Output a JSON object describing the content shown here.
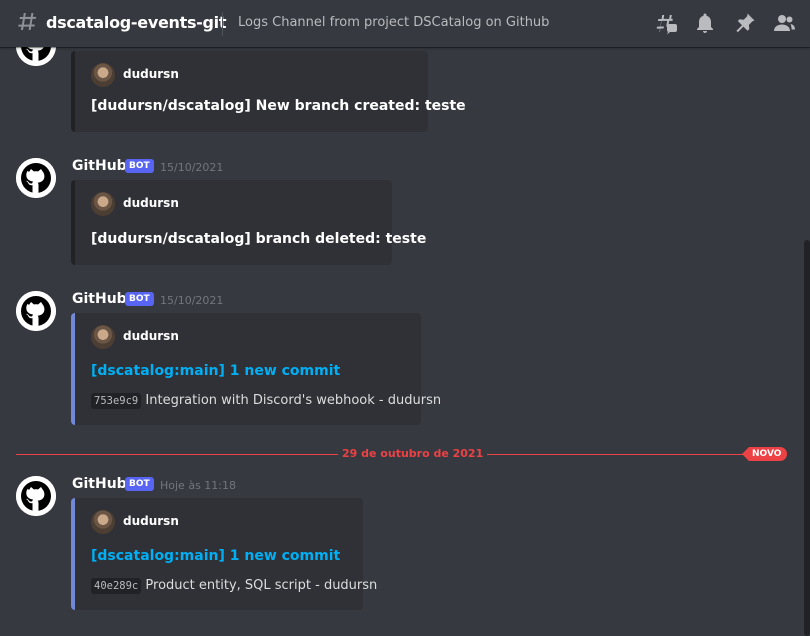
{
  "header": {
    "channel_name": "dscatalog-events-git",
    "topic": "Logs Channel from project DSCatalog on Github"
  },
  "messages": [
    {
      "author": "",
      "bot_label": "",
      "timestamp": "",
      "embed_author": "dudursn",
      "embed_title": "[dudursn/dscatalog] New branch created: teste"
    },
    {
      "author": "GitHub",
      "bot_label": "BOT",
      "timestamp": "15/10/2021",
      "embed_author": "dudursn",
      "embed_title": "[dudursn/dscatalog] branch deleted: teste"
    },
    {
      "author": "GitHub",
      "bot_label": "BOT",
      "timestamp": "15/10/2021",
      "embed_author": "dudursn",
      "embed_title": "[dscatalog:main] 1 new commit",
      "commit_hash": "753e9c9",
      "commit_text": "Integration with Discord's webhook - dudursn"
    },
    {
      "author": "GitHub",
      "bot_label": "BOT",
      "timestamp": "Hoje às 11:18",
      "embed_author": "dudursn",
      "embed_title": "[dscatalog:main] 1 new commit",
      "commit_hash": "40e289c",
      "commit_text": "Product entity, SQL script - dudursn"
    }
  ],
  "date_separator": {
    "label": "29 de outubro de 2021",
    "new_label": "NOVO"
  },
  "icons": {
    "channel": "hashtag-icon",
    "threads": "threads-icon",
    "notifications": "bell-icon",
    "pinned": "pin-icon",
    "members": "members-icon",
    "avatar": "github-icon"
  },
  "colors": {
    "background": "#36393f",
    "embed_bg": "#2f3136",
    "link": "#00aff4",
    "bot_tag": "#5865f2",
    "new_marker": "#ed4245",
    "embed_accent": "#7289da"
  }
}
